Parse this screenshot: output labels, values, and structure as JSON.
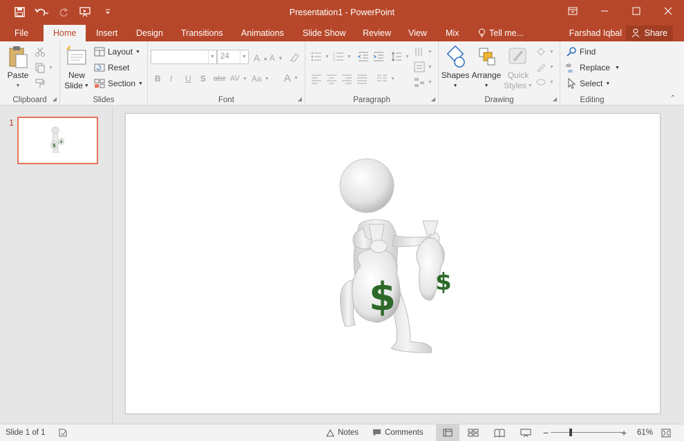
{
  "window": {
    "title": "Presentation1 - PowerPoint",
    "controls": [
      "ribbon-display-options",
      "minimize",
      "maximize",
      "close"
    ]
  },
  "qat": {
    "save": "save-icon",
    "undo": "undo-icon",
    "redo": "redo-icon",
    "present": "present-from-start-icon",
    "customize": "customize-qat-icon"
  },
  "tabs": [
    {
      "label": "File"
    },
    {
      "label": "Home"
    },
    {
      "label": "Insert"
    },
    {
      "label": "Design"
    },
    {
      "label": "Transitions"
    },
    {
      "label": "Animations"
    },
    {
      "label": "Slide Show"
    },
    {
      "label": "Review"
    },
    {
      "label": "View"
    },
    {
      "label": "Mix"
    },
    {
      "label": "Tell me..."
    }
  ],
  "active_tab": "Home",
  "user": {
    "name": "Farshad Iqbal"
  },
  "share": {
    "label": "Share"
  },
  "ribbon": {
    "clipboard": {
      "label": "Clipboard",
      "paste": "Paste"
    },
    "slides": {
      "label": "Slides",
      "new_slide_1": "New",
      "new_slide_2": "Slide",
      "layout": "Layout",
      "reset": "Reset",
      "section": "Section"
    },
    "font": {
      "label": "Font",
      "font_name": "",
      "font_size": "24"
    },
    "paragraph": {
      "label": "Paragraph"
    },
    "drawing": {
      "label": "Drawing",
      "shapes": "Shapes",
      "arrange": "Arrange",
      "quick_styles_1": "Quick",
      "quick_styles_2": "Styles"
    },
    "editing": {
      "label": "Editing",
      "find": "Find",
      "replace": "Replace",
      "select": "Select"
    }
  },
  "thumbnails": [
    {
      "number": "1"
    }
  ],
  "slide": {
    "image": "stick-figure-carrying-money-bags"
  },
  "status": {
    "slide_info": "Slide 1 of 1",
    "notes": "Notes",
    "comments": "Comments",
    "zoom": "61%"
  },
  "colors": {
    "accent": "#b7472a",
    "selection": "#e9735a",
    "dollar": "#2d6a2a"
  }
}
